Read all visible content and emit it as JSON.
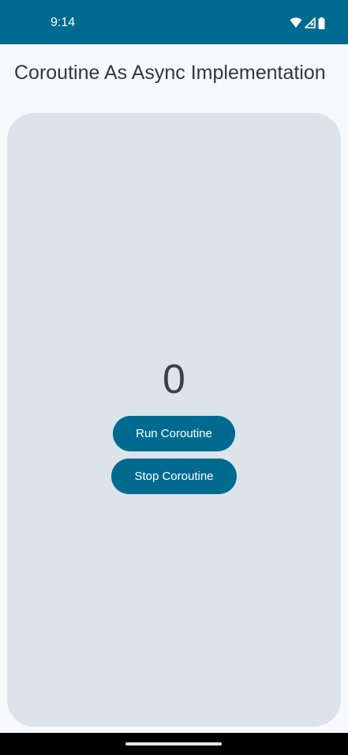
{
  "status_bar": {
    "time": "9:14",
    "icons": [
      "wifi-icon",
      "cell-signal-icon",
      "battery-icon"
    ],
    "background": "#006b8f"
  },
  "app": {
    "title": "Coroutine As Async Implementation"
  },
  "counter": {
    "value": "0"
  },
  "buttons": {
    "run_label": "Run Coroutine",
    "stop_label": "Stop Coroutine",
    "color": "#006b8f"
  },
  "card": {
    "background": "#dce3ea"
  }
}
